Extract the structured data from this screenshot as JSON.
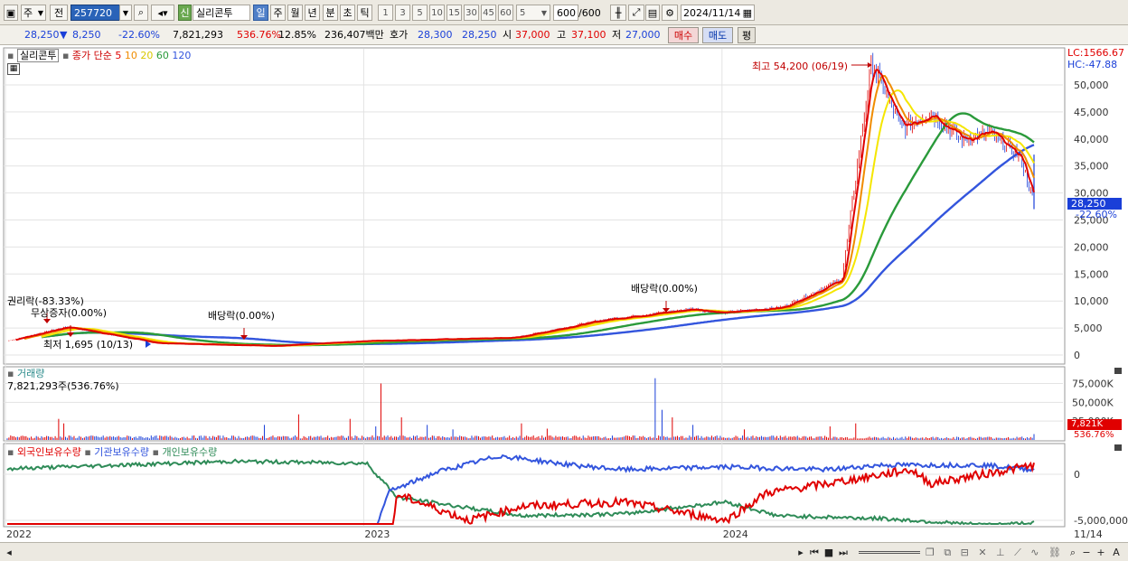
{
  "toolbar": {
    "period_select": "주",
    "prev_label": "전",
    "stock_code": "257720",
    "market_badge": "신",
    "stock_name": "실리콘투",
    "periods": [
      "일",
      "주",
      "월",
      "년",
      "분",
      "초",
      "틱"
    ],
    "active_period": "일",
    "intervals": [
      "1",
      "3",
      "5",
      "10",
      "15",
      "30",
      "45",
      "60"
    ],
    "interval_select": "5",
    "count_value": "600",
    "count_total": "/600",
    "date": "2024/11/14"
  },
  "infobar": {
    "price": "28,250",
    "change_arrow": "▼",
    "change": "8,250",
    "change_pct": "-22.60%",
    "volume": "7,821,293",
    "volume_ratio": "536.76%",
    "turnover": "12.85%",
    "amount": "236,407백만",
    "quote_label": "호가",
    "ask": "28,300",
    "bid": "28,250",
    "open_label": "시",
    "open": "37,000",
    "high_label": "고",
    "high": "37,100",
    "low_label": "저",
    "low": "27,000",
    "buy_button": "매수",
    "sell_button": "매도",
    "eval_button": "평"
  },
  "price_panel": {
    "name_tag": "실리콘투",
    "legend_prefix": "종가 단순",
    "ma_labels": [
      "5",
      "10",
      "20",
      "60",
      "120"
    ],
    "lc_label": "LC:1566.67",
    "hc_label": "HC:-47.88",
    "current_price_tag": "28,250",
    "current_change_tag": "-22.60%",
    "annotations": {
      "high": "최고 54,200 (06/19)",
      "low": "최저 1,695 (10/13)",
      "rights": "권리락(-83.33%)",
      "bonus": "무상증자(0.00%)",
      "dividend1": "배당락(0.00%)",
      "dividend2": "배당락(0.00%)"
    },
    "y_ticks": [
      "50,000",
      "45,000",
      "40,000",
      "35,000",
      "30,000",
      "25,000",
      "20,000",
      "15,000",
      "10,000",
      "5,000",
      "0"
    ]
  },
  "volume_panel": {
    "title": "거래량",
    "value_label": "7,821,293주(536.76%)",
    "y_ticks": [
      "75,000K",
      "50,000K",
      "25,000K"
    ],
    "current_tag": "7,821K",
    "current_pct": "536.76%"
  },
  "holdings_panel": {
    "foreign_label": "외국인보유수량",
    "inst_label": "기관보유수량",
    "retail_label": "개인보유수량",
    "y_ticks": [
      "0",
      "-5,000,000"
    ]
  },
  "x_axis": {
    "labels": [
      "2022",
      "2023",
      "2024"
    ],
    "last_date": "11/14"
  },
  "colors": {
    "up": "#e00000",
    "down": "#1a3fd8",
    "ma5": "#e00000",
    "ma10": "#f08c00",
    "ma20": "#f5e600",
    "ma60": "#2a9a3a",
    "ma120": "#3355dd",
    "foreign": "#e00000",
    "inst": "#3355dd",
    "retail": "#2e8b57"
  },
  "chart_data": {
    "type": "line",
    "title": "실리콘투",
    "x": [
      "2022",
      "2023",
      "2024",
      "11/14"
    ],
    "series": [
      {
        "name": "종가",
        "points": [
          [
            "2022-01",
            2600
          ],
          [
            "2022-03",
            5200
          ],
          [
            "2022-06",
            2200
          ],
          [
            "2022-10",
            1695
          ],
          [
            "2023-01",
            2600
          ],
          [
            "2023-06",
            3200
          ],
          [
            "2023-09",
            6500
          ],
          [
            "2023-12",
            8500
          ],
          [
            "2024-01",
            7800
          ],
          [
            "2024-03",
            8800
          ],
          [
            "2024-05",
            14000
          ],
          [
            "2024-06",
            54200
          ],
          [
            "2024-07",
            42000
          ],
          [
            "2024-08",
            45000
          ],
          [
            "2024-09",
            40000
          ],
          [
            "2024-10",
            41000
          ],
          [
            "2024-11",
            36500
          ],
          [
            "2024-11-14",
            28250
          ]
        ]
      },
      {
        "name": "120",
        "points": [
          [
            "2022-09",
            2500
          ],
          [
            "2023-06",
            3000
          ],
          [
            "2023-12",
            8000
          ],
          [
            "2024-05",
            9500
          ],
          [
            "2024-07",
            25000
          ],
          [
            "2024-09",
            35000
          ],
          [
            "2024-11",
            42000
          ]
        ]
      }
    ],
    "volume": {
      "name": "거래량",
      "last": 7821293,
      "last_ratio_pct": 536.76,
      "ylim": [
        0,
        90000000
      ]
    },
    "ylim": [
      0,
      55000
    ]
  }
}
